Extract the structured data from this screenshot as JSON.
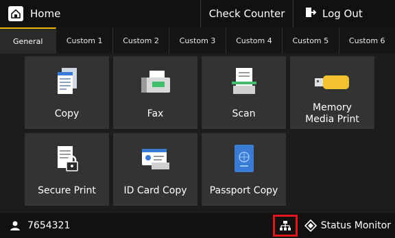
{
  "topbar": {
    "home_label": "Home",
    "check_counter_label": "Check Counter",
    "logout_label": "Log Out"
  },
  "tabs": [
    {
      "label": "General",
      "active": true
    },
    {
      "label": "Custom 1",
      "active": false
    },
    {
      "label": "Custom 2",
      "active": false
    },
    {
      "label": "Custom 3",
      "active": false
    },
    {
      "label": "Custom 4",
      "active": false
    },
    {
      "label": "Custom 5",
      "active": false
    },
    {
      "label": "Custom 6",
      "active": false
    }
  ],
  "tiles": [
    {
      "label": "Copy",
      "icon": "copy-icon"
    },
    {
      "label": "Fax",
      "icon": "fax-icon"
    },
    {
      "label": "Scan",
      "icon": "scan-icon"
    },
    {
      "label": "Memory Media Print",
      "icon": "usb-memory-icon"
    },
    {
      "label": "Secure Print",
      "icon": "secure-print-icon"
    },
    {
      "label": "ID Card Copy",
      "icon": "id-card-icon"
    },
    {
      "label": "Passport Copy",
      "icon": "passport-icon"
    }
  ],
  "bottombar": {
    "user_id": "7654321",
    "status_monitor_label": "Status Monitor"
  },
  "colors": {
    "accent": "#f0b400",
    "highlight": "#e3161b",
    "tile_bg": "#333333",
    "bar_bg": "#111111"
  }
}
